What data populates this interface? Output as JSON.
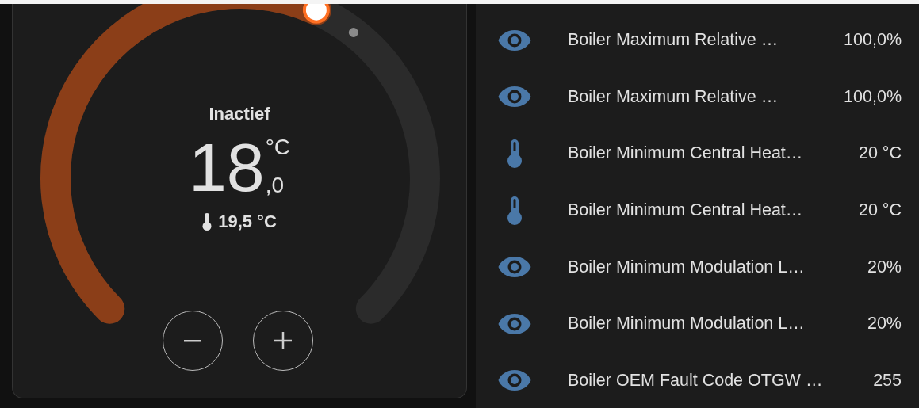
{
  "thermostat": {
    "status": "Inactief",
    "target": {
      "whole": "18",
      "decimal": ",0",
      "unit": "°C"
    },
    "current_temperature": "19,5 °C",
    "buttons": [
      {
        "kind": "minus"
      },
      {
        "kind": "plus"
      }
    ]
  },
  "entities": [
    {
      "kind": "sensor",
      "name": "Boiler Maximum Relative …",
      "value": "100,0%"
    },
    {
      "kind": "sensor",
      "name": "Boiler Maximum Relative …",
      "value": "100,0%"
    },
    {
      "kind": "temperature",
      "name": "Boiler Minimum Central Heat…",
      "value": "20 °C"
    },
    {
      "kind": "temperature",
      "name": "Boiler Minimum Central Heat…",
      "value": "20 °C"
    },
    {
      "kind": "sensor",
      "name": "Boiler Minimum Modulation L…",
      "value": "20%"
    },
    {
      "kind": "sensor",
      "name": "Boiler Minimum Modulation L…",
      "value": "20%"
    },
    {
      "kind": "sensor",
      "name": "Boiler OEM Fault Code OTGW …",
      "value": "255"
    }
  ]
}
